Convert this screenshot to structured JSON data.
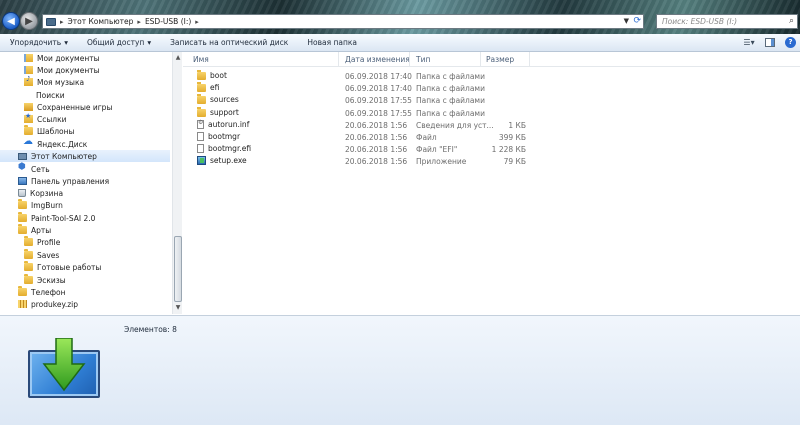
{
  "address": {
    "crumbs": [
      "Этот Компьютер",
      "ESD-USB (I:)"
    ]
  },
  "search": {
    "placeholder": "Поиск: ESD-USB (I:)"
  },
  "toolbar": {
    "organize": "Упорядочить",
    "share": "Общий доступ",
    "burn": "Записать на оптический диск",
    "new_folder": "Новая папка"
  },
  "sidebar": {
    "items": [
      {
        "label": "Мои документы",
        "icon": "docs-folder-icon"
      },
      {
        "label": "Мои документы",
        "icon": "docs-folder-icon"
      },
      {
        "label": "Моя музыка",
        "icon": "music-folder-icon"
      },
      {
        "label": "Поиски",
        "icon": "search-folder-icon"
      },
      {
        "label": "Сохраненные игры",
        "icon": "games-folder-icon"
      },
      {
        "label": "Ссылки",
        "icon": "links-folder-icon"
      },
      {
        "label": "Шаблоны",
        "icon": "folder-icon"
      },
      {
        "label": "Яндекс.Диск",
        "icon": "cloud-icon"
      },
      {
        "label": "Этот Компьютер",
        "icon": "computer-icon"
      },
      {
        "label": "Сеть",
        "icon": "network-icon"
      },
      {
        "label": "Панель управления",
        "icon": "control-panel-icon"
      },
      {
        "label": "Корзина",
        "icon": "recycle-bin-icon"
      },
      {
        "label": "ImgBurn",
        "icon": "folder-icon"
      },
      {
        "label": "Paint-Tool-SAI 2.0",
        "icon": "folder-icon"
      },
      {
        "label": "Арты",
        "icon": "folder-icon"
      },
      {
        "label": "Profile",
        "icon": "folder-icon"
      },
      {
        "label": "Saves",
        "icon": "folder-icon"
      },
      {
        "label": "Готовые работы",
        "icon": "folder-icon"
      },
      {
        "label": "Эскизы",
        "icon": "folder-icon"
      },
      {
        "label": "Телефон",
        "icon": "folder-icon"
      },
      {
        "label": "produkey.zip",
        "icon": "zip-icon"
      }
    ]
  },
  "columns": {
    "name": "Имя",
    "date": "Дата изменения",
    "type": "Тип",
    "size": "Размер"
  },
  "files": [
    {
      "name": "boot",
      "date": "06.09.2018 17:40",
      "type": "Папка с файлами",
      "size": "",
      "icon": "folder-icon"
    },
    {
      "name": "efi",
      "date": "06.09.2018 17:40",
      "type": "Папка с файлами",
      "size": "",
      "icon": "folder-icon"
    },
    {
      "name": "sources",
      "date": "06.09.2018 17:55",
      "type": "Папка с файлами",
      "size": "",
      "icon": "folder-icon"
    },
    {
      "name": "support",
      "date": "06.09.2018 17:55",
      "type": "Папка с файлами",
      "size": "",
      "icon": "folder-icon"
    },
    {
      "name": "autorun.inf",
      "date": "20.06.2018 1:56",
      "type": "Сведения для уст...",
      "size": "1 КБ",
      "icon": "settings-file-icon"
    },
    {
      "name": "bootmgr",
      "date": "20.06.2018 1:56",
      "type": "Файл",
      "size": "399 КБ",
      "icon": "file-icon"
    },
    {
      "name": "bootmgr.efi",
      "date": "20.06.2018 1:56",
      "type": "Файл \"EFI\"",
      "size": "1 228 КБ",
      "icon": "file-icon"
    },
    {
      "name": "setup.exe",
      "date": "20.06.2018 1:56",
      "type": "Приложение",
      "size": "79 КБ",
      "icon": "exe-icon"
    }
  ],
  "details": {
    "count": "Элементов: 8"
  }
}
